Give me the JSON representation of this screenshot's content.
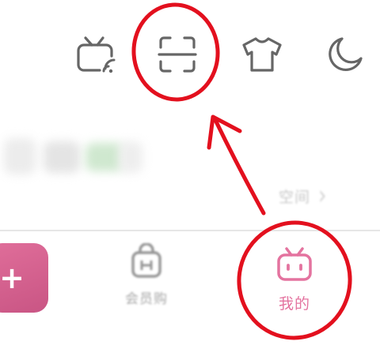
{
  "header": {
    "icons": [
      "cast-tv-icon",
      "scan-qr-icon",
      "theme-shirt-icon",
      "night-mode-moon-icon"
    ]
  },
  "profile": {
    "space_link_label": "空间",
    "space_link_chevron": "›"
  },
  "tabbar": {
    "fab_symbol": "+",
    "tabs": [
      {
        "label": "会员购",
        "icon": "shopping-bag-icon",
        "active": false
      },
      {
        "label": "我的",
        "icon": "bilibili-tv-icon",
        "active": true
      }
    ]
  },
  "annotation": {
    "color": "#e3101e",
    "highlighted_items": [
      "scan-qr-icon",
      "tab-mine"
    ]
  },
  "colors": {
    "accent_pink": "#e4739f",
    "icon_gray": "#666666",
    "annotation_red": "#e3101e"
  }
}
